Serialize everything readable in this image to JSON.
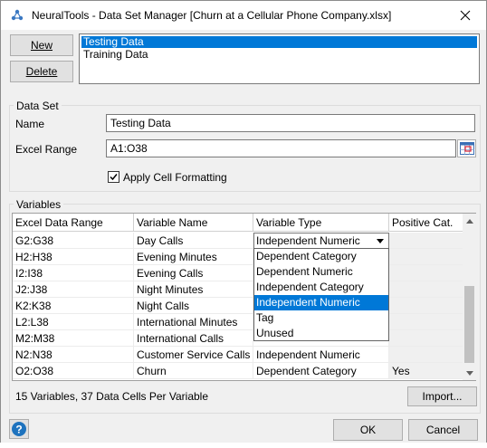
{
  "window": {
    "title": "NeuralTools - Data Set Manager [Churn at a Cellular Phone Company.xlsx]"
  },
  "buttons": {
    "new": "New",
    "delete": "Delete",
    "import": "Import...",
    "ok": "OK",
    "cancel": "Cancel"
  },
  "datasets": [
    "Testing Data",
    "Training Data"
  ],
  "data_set_group": {
    "label": "Data Set",
    "name_label": "Name",
    "name_value": "Testing Data",
    "range_label": "Excel Range",
    "range_value": "A1:O38",
    "apply_label": "Apply Cell Formatting",
    "apply_checked": true
  },
  "variables_group": {
    "label": "Variables",
    "columns": [
      "Excel Data Range",
      "Variable Name",
      "Variable Type",
      "Positive Cat."
    ],
    "rows": [
      {
        "range": "G2:G38",
        "name": "Day Calls",
        "type": "Independent Numeric",
        "pos": ""
      },
      {
        "range": "H2:H38",
        "name": "Evening Minutes",
        "type": "",
        "pos": ""
      },
      {
        "range": "I2:I38",
        "name": "Evening Calls",
        "type": "",
        "pos": ""
      },
      {
        "range": "J2:J38",
        "name": "Night Minutes",
        "type": "",
        "pos": ""
      },
      {
        "range": "K2:K38",
        "name": "Night Calls",
        "type": "",
        "pos": ""
      },
      {
        "range": "L2:L38",
        "name": "International Minutes",
        "type": "",
        "pos": ""
      },
      {
        "range": "M2:M38",
        "name": "International Calls",
        "type": "",
        "pos": ""
      },
      {
        "range": "N2:N38",
        "name": "Customer Service Calls",
        "type": "Independent Numeric",
        "pos": ""
      },
      {
        "range": "O2:O38",
        "name": "Churn",
        "type": "Dependent Category",
        "pos": "Yes"
      }
    ],
    "dropdown_options": [
      "Dependent Category",
      "Dependent Numeric",
      "Independent Category",
      "Independent Numeric",
      "Tag",
      "Unused"
    ],
    "dropdown_selected": "Independent Numeric",
    "status": "15 Variables, 37 Data Cells Per Variable"
  },
  "colors": {
    "selection": "#0078d7",
    "dialog_bg": "#f0f0f0"
  }
}
